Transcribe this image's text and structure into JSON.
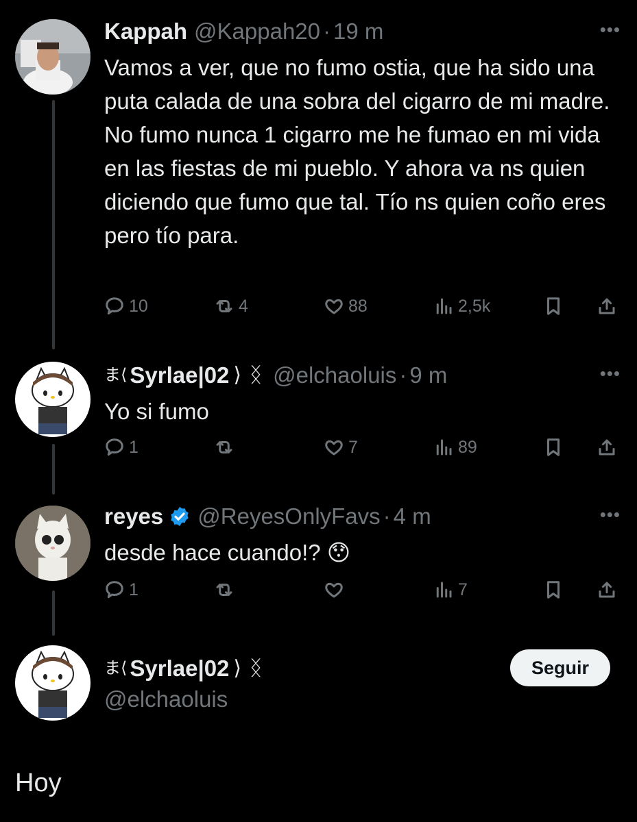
{
  "tweets": [
    {
      "name": "Kappah",
      "handle": "@Kappah20",
      "time": "19 m",
      "text": "Vamos a ver, que no fumo ostia, que ha sido una puta calada de una sobra del cigarro de mi madre. No fumo nunca 1 cigarro me he fumao en mi vida en las fiestas de mi pueblo. Y ahora va ns quien diciendo que fumo que tal. Tío ns quien coño eres pero tío para.",
      "replies": "10",
      "reposts": "4",
      "likes": "88",
      "views": "2,5k"
    },
    {
      "prefix": "ま⟨",
      "name": "Syrlae|02",
      "suffix": "⟩",
      "badge": "ᛝ",
      "handle": "@elchaoluis",
      "time": "9 m",
      "text": "Yo si fumo",
      "replies": "1",
      "reposts": "",
      "likes": "7",
      "views": "89"
    },
    {
      "name": "reyes",
      "handle": "@ReyesOnlyFavs",
      "time": "4 m",
      "text": "desde hace cuando!? 😯",
      "replies": "1",
      "reposts": "",
      "likes": "",
      "views": "7"
    }
  ],
  "composer": {
    "prefix": "ま⟨",
    "name": "Syrlae|02",
    "suffix": "⟩",
    "badge": "ᛝ",
    "handle": "@elchaoluis",
    "follow_label": "Seguir",
    "text": "Hoy"
  },
  "separator": "·",
  "more": "•••",
  "colors": {
    "background": "#000000",
    "text": "#e7e9ea",
    "muted": "#71767b",
    "verified": "#1d9bf0"
  },
  "icons": [
    "reply-icon",
    "repost-icon",
    "like-icon",
    "views-icon",
    "bookmark-icon",
    "share-icon",
    "more-icon",
    "verified-icon"
  ]
}
